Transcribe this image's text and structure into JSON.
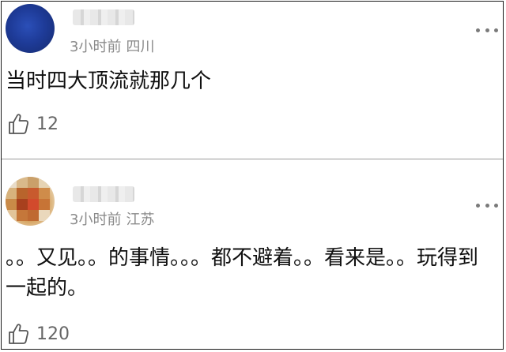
{
  "comments": [
    {
      "time": "3小时前",
      "location": "四川",
      "text": "当时四大顶流就那几个",
      "likes": "12"
    },
    {
      "time": "3小时前",
      "location": "江苏",
      "text": "。。又见。。的事情。。。都不避着。。看来是。。玩得到一起的。",
      "likes": "120"
    }
  ],
  "icons": {
    "like": "thumbs-up-icon",
    "more": "more-dots-icon"
  },
  "colors": {
    "text": "#101010",
    "meta": "#8a8a8a",
    "border": "#1a1a1a"
  }
}
